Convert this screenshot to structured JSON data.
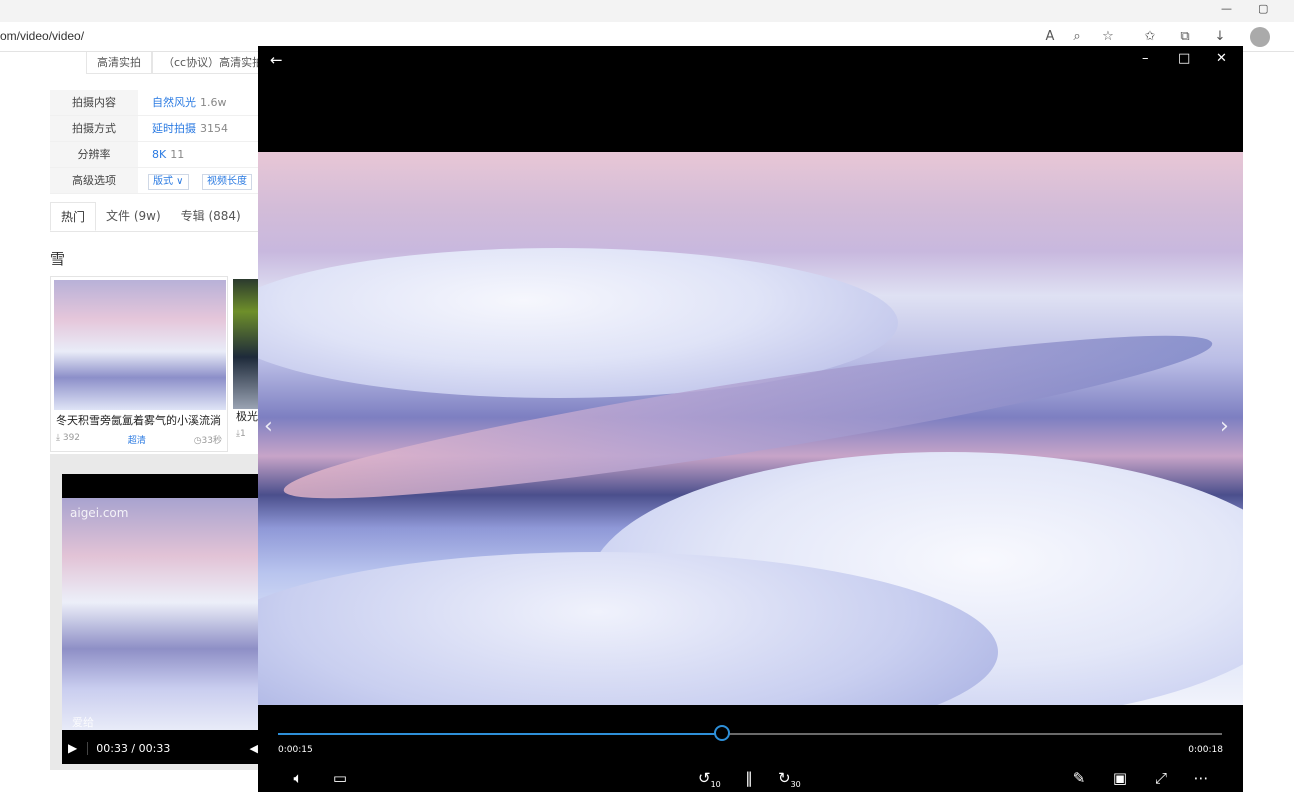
{
  "browser": {
    "url": "om/video/video/",
    "window_controls": {
      "minimize": "—",
      "restore": "▢"
    }
  },
  "webpage": {
    "category_tabs": [
      "高清实拍",
      "（cc协议）高清实拍"
    ],
    "filters": [
      {
        "label": "拍摄内容",
        "value": "自然风光",
        "count": "1.6w"
      },
      {
        "label": "拍摄方式",
        "value": "延时拍摄",
        "count": "3154"
      },
      {
        "label": "分辨率",
        "value": "8K",
        "count": "11"
      }
    ],
    "advanced": {
      "label": "高级选项",
      "select1": "版式 ∨",
      "select2": "视频长度"
    },
    "result_tabs": [
      "热门",
      "文件 (9w)",
      "专辑 (884)"
    ],
    "query": "雪",
    "card1": {
      "title": "冬天积雪旁氤氲着雾气的小溪流淌",
      "downloads": "392",
      "quality": "超清",
      "duration": "33秒"
    },
    "card2": {
      "title": "极光",
      "downloads": "1"
    },
    "preview": {
      "watermark": "aigei.com",
      "watermark2": "爱给",
      "time": "00:33 / 00:33"
    }
  },
  "player": {
    "current_time": "0:00:15",
    "total_time": "0:00:18",
    "progress": 0.47,
    "colors": {
      "accent": "#2e8fd8"
    },
    "icons": [
      "back-arrow-icon",
      "minimize-icon",
      "maximize-icon",
      "close-icon",
      "volume-icon",
      "captions-icon",
      "rewind-10-icon",
      "pause-icon",
      "forward-30-icon",
      "edit-icon",
      "mini-view-icon",
      "fullscreen-icon",
      "more-icon"
    ],
    "skip_back": "10",
    "skip_forward": "30"
  }
}
